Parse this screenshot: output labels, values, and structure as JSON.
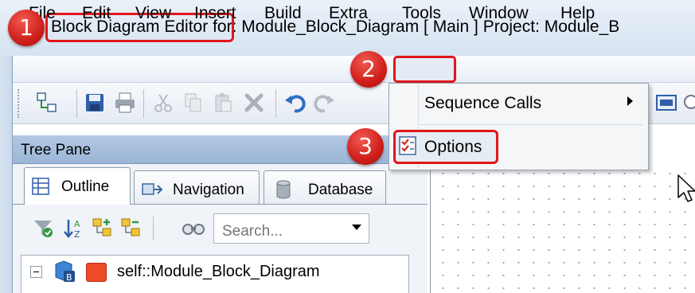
{
  "window": {
    "title_highlight": "Block Diagram Editor",
    "title_rest": " for: Module_Block_Diagram [ Main ] Project: Module_B"
  },
  "menubar": {
    "items": [
      "File",
      "Edit",
      "View",
      "Insert",
      "Build",
      "Extra",
      "Tools",
      "Window",
      "Help"
    ]
  },
  "tools_menu": {
    "items": [
      {
        "label": "Sequence Calls",
        "has_submenu": true
      },
      {
        "label": "Options",
        "icon": "options-checklist-icon"
      }
    ]
  },
  "steps": [
    "1",
    "2",
    "3"
  ],
  "tree_pane": {
    "title": "Tree Pane",
    "tabs": [
      {
        "label": "Outline",
        "icon": "outline-icon",
        "active": true
      },
      {
        "label": "Navigation",
        "icon": "navigation-icon",
        "active": false
      },
      {
        "label": "Database",
        "icon": "database-icon",
        "active": false
      }
    ],
    "search_placeholder": "Search...",
    "tree": [
      {
        "label": "self::Module_Block_Diagram",
        "expanded": true
      }
    ]
  },
  "colors": {
    "highlight": "#e0161b",
    "badge": "#cf1f1a",
    "tree_header": "#a8c0de"
  }
}
